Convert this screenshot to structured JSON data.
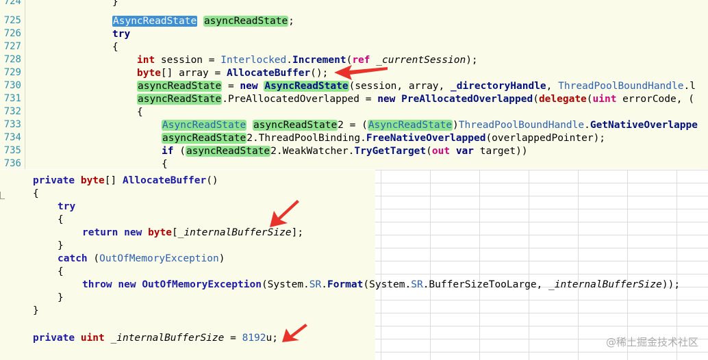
{
  "top": {
    "line_numbers": [
      "724",
      "725",
      "726",
      "727",
      "728",
      "729",
      "730",
      "731",
      "732",
      "733",
      "734",
      "735",
      "736"
    ],
    "l724": "}",
    "l725_a": "AsyncReadState",
    "l725_b": "asyncReadState",
    "l725_c": ";",
    "l726": "try",
    "l727": "{",
    "l728_a": "int",
    "l728_b": " session = ",
    "l728_c": "Interlocked",
    "l728_d": ".",
    "l728_e": "Increment",
    "l728_f": "(",
    "l728_g": "ref",
    "l728_h": " ",
    "l728_i": "_currentSession",
    "l728_j": ");",
    "l729_a": "byte",
    "l729_b": "[] array = ",
    "l729_c": "AllocateBuffer",
    "l729_d": "();",
    "l730_a": "asyncReadState",
    "l730_b": " = ",
    "l730_c": "new",
    "l730_d": " ",
    "l730_e": "AsyncReadState",
    "l730_f": "(session, array, ",
    "l730_g": "_directoryHandle",
    "l730_h": ", ",
    "l730_i": "ThreadPoolBoundHandle",
    "l730_j": ".l",
    "l731_a": "asyncReadState",
    "l731_b": ".PreAllocatedOverlapped = ",
    "l731_c": "new",
    "l731_d": " ",
    "l731_e": "PreAllocatedOverlapped",
    "l731_f": "(",
    "l731_g": "delegate",
    "l731_h": "(",
    "l731_i": "uint",
    "l731_j": " errorCode, (",
    "l732": "{",
    "l733_a": "AsyncReadState",
    "l733_b": "asyncReadState",
    "l733_c": "2 = (",
    "l733_d": "AsyncReadState",
    "l733_e": ")",
    "l733_f": "ThreadPoolBoundHandle",
    "l733_g": ".",
    "l733_h": "GetNativeOverlappe",
    "l734_a": "asyncReadState",
    "l734_b": "2.ThreadPoolBinding.",
    "l734_c": "FreeNativeOverlapped",
    "l734_d": "(overlappedPointer);",
    "l735_a": "if",
    "l735_b": " (",
    "l735_c": "asyncReadState",
    "l735_d": "2.WeakWatcher.",
    "l735_e": "TryGetTarget",
    "l735_f": "(",
    "l735_g": "out",
    "l735_h": " ",
    "l735_i": "var",
    "l735_j": " target))",
    "l736": "{"
  },
  "bottom": {
    "b1_a": "private",
    "b1_b": " ",
    "b1_c": "byte",
    "b1_d": "[] ",
    "b1_e": "AllocateBuffer",
    "b1_f": "()",
    "b2": "{",
    "b3": "try",
    "b4": "{",
    "b5_a": "return",
    "b5_b": " ",
    "b5_c": "new",
    "b5_d": " ",
    "b5_e": "byte",
    "b5_f": "[",
    "b5_g": "_internalBufferSize",
    "b5_h": "];",
    "b6": "}",
    "b7_a": "catch",
    "b7_b": " (",
    "b7_c": "OutOfMemoryException",
    "b7_d": ")",
    "b8": "{",
    "b9_a": "throw",
    "b9_b": " ",
    "b9_c": "new",
    "b9_d": " ",
    "b9_e": "OutOfMemoryException",
    "b9_f": "(System.",
    "b9_g": "SR",
    "b9_h": ".",
    "b9_i": "Format",
    "b9_j": "(System.",
    "b9_k": "SR",
    "b9_l": ".BufferSizeTooLarge, ",
    "b9_m": "_internalBufferSize",
    "b9_n": "));",
    "b10": "}",
    "b11": "}",
    "b12_a": "private",
    "b12_b": " ",
    "b12_c": "uint",
    "b12_d": " ",
    "b12_e": "_internalBufferSize",
    "b12_f": " = ",
    "b12_g": "8192",
    "b12_h": "u;"
  },
  "watermark": "@稀土掘金技术社区",
  "colors": {
    "arrow": "#e8322a",
    "highlight_green": "#8fe68f",
    "highlight_blue": "#3d8fd6"
  }
}
